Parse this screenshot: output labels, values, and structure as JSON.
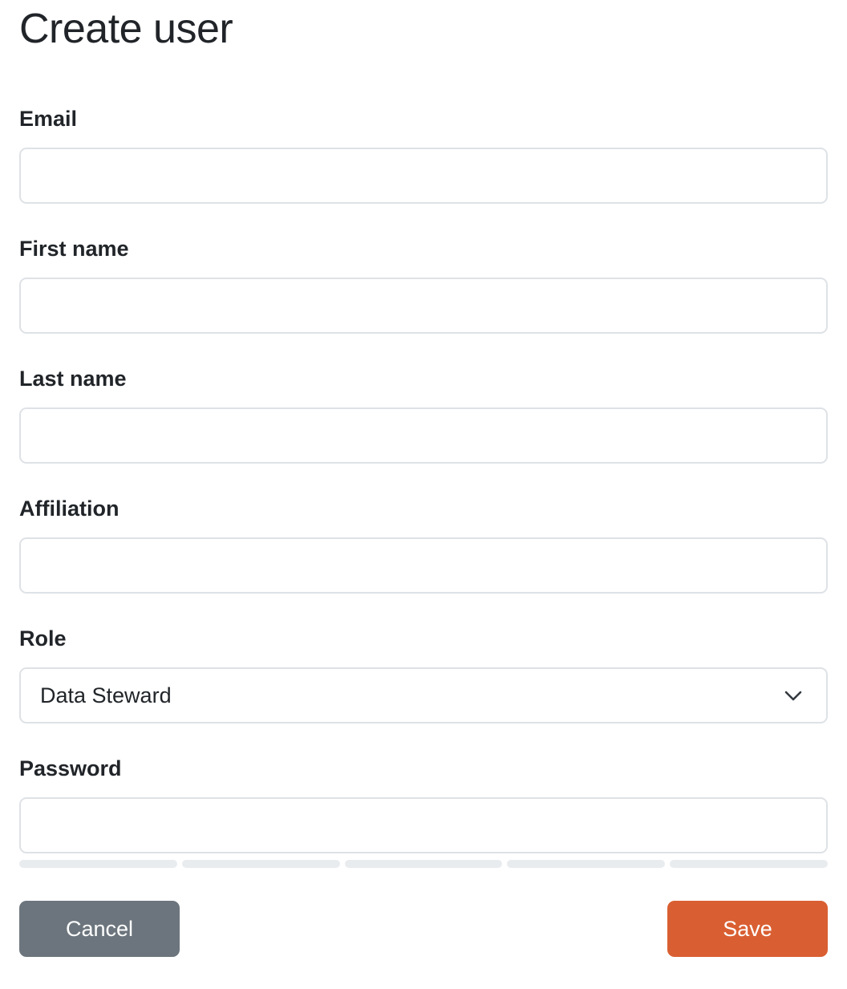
{
  "page": {
    "title": "Create user"
  },
  "form": {
    "email": {
      "label": "Email",
      "value": "",
      "placeholder": ""
    },
    "first_name": {
      "label": "First name",
      "value": "",
      "placeholder": ""
    },
    "last_name": {
      "label": "Last name",
      "value": "",
      "placeholder": ""
    },
    "affiliation": {
      "label": "Affiliation",
      "value": "",
      "placeholder": ""
    },
    "role": {
      "label": "Role",
      "selected": "Data Steward",
      "icon": "chevron-down-icon"
    },
    "password": {
      "label": "Password",
      "value": "",
      "placeholder": "",
      "strength": {
        "segments": 5,
        "filled": 0,
        "empty_color": "#e9ecef"
      }
    }
  },
  "actions": {
    "cancel_label": "Cancel",
    "save_label": "Save"
  },
  "colors": {
    "cancel_bg": "#6c757d",
    "save_bg": "#d95f32",
    "input_border": "#dee2e6",
    "text": "#212529"
  }
}
